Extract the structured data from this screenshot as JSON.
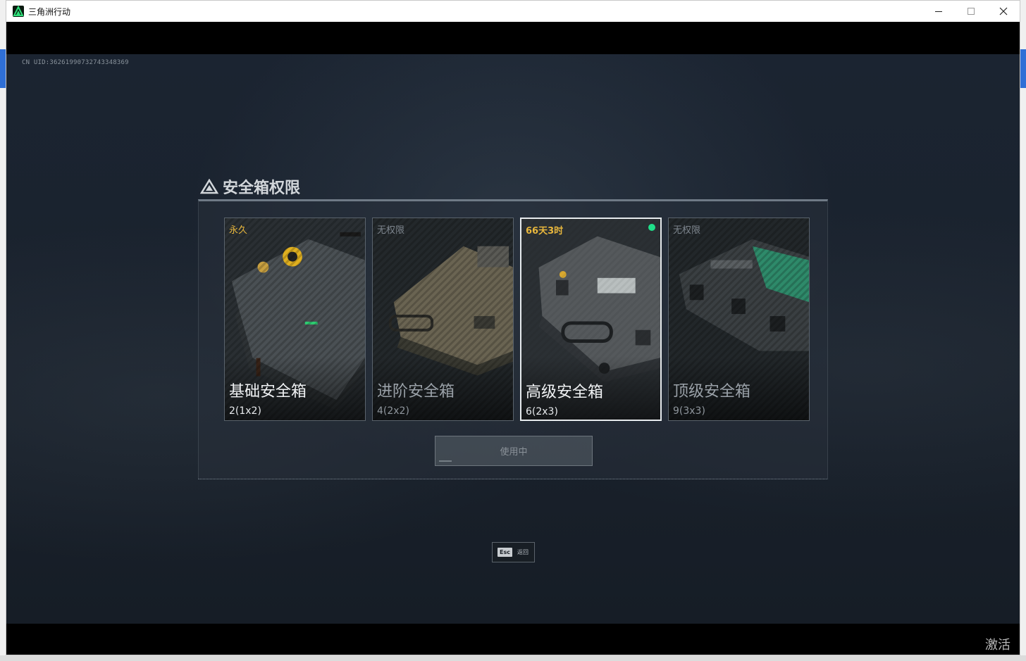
{
  "window": {
    "title": "三角洲行动"
  },
  "game": {
    "uid": "CN UID:3626199073274334836​9",
    "panel_title": "安全箱权限",
    "cards": [
      {
        "status": "永久",
        "name": "基础安全箱",
        "size": "2(1x2)",
        "state": "owned"
      },
      {
        "status": "无权限",
        "name": "进阶安全箱",
        "size": "4(2x2)",
        "state": "locked"
      },
      {
        "status": "66天3时",
        "name": "高级安全箱",
        "size": "6(2x3)",
        "state": "active"
      },
      {
        "status": "无权限",
        "name": "顶级安全箱",
        "size": "9(3x3)",
        "state": "locked"
      }
    ],
    "use_button": "使用中",
    "esc_key": "Esc",
    "esc_label": "返回"
  },
  "os": {
    "watermark": "激活"
  },
  "colors": {
    "accent_gold": "#e8b73d",
    "active_green": "#1fe08a",
    "panel_bg": "#1b2431"
  }
}
